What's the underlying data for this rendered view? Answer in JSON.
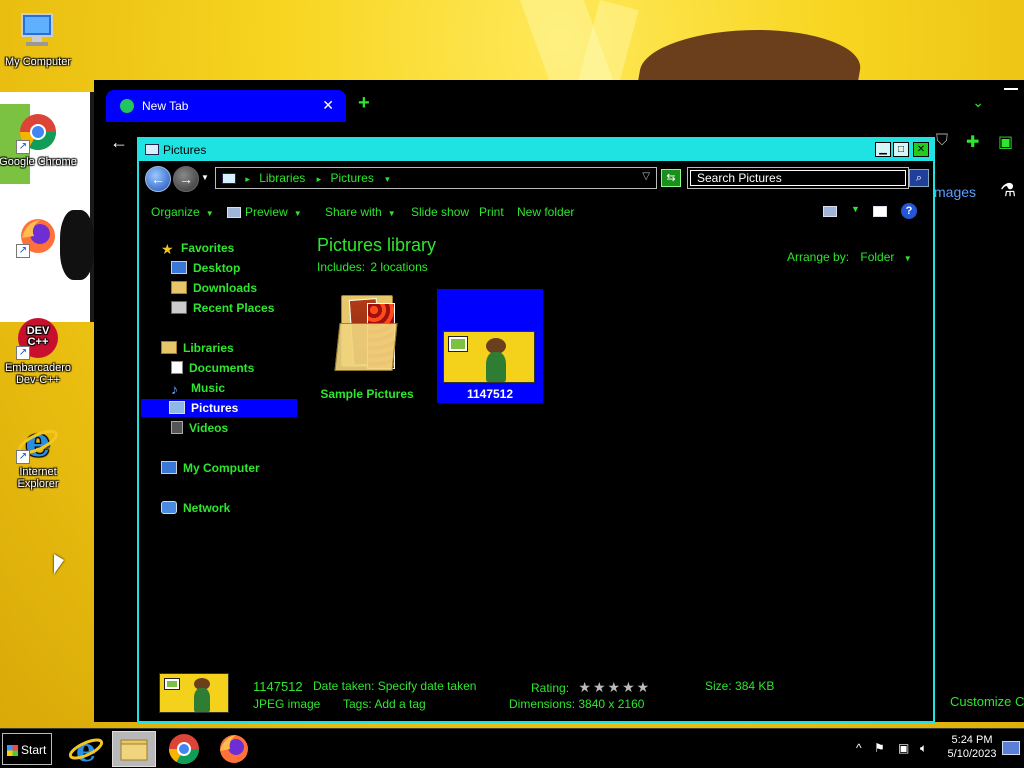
{
  "desktop": {
    "icons": [
      {
        "label": "My Computer",
        "icon": "monitor-icon"
      },
      {
        "label": "Google Chrome",
        "icon": "chrome-icon"
      },
      {
        "label": "Firefox",
        "icon": "firefox-icon"
      },
      {
        "label": "Embarcadero Dev-C++",
        "icon": "devcpp-icon"
      },
      {
        "label": "Internet Explorer",
        "icon": "ie-icon"
      }
    ],
    "devcpp_badge": "DEV C++"
  },
  "browser": {
    "tab_title": "New Tab",
    "tab_close": "✕",
    "new_tab": "+",
    "back": "←",
    "images_link": "mages",
    "customize_link": "Customize C"
  },
  "explorer": {
    "title": "Pictures",
    "controls": {
      "minimize": "▁",
      "maximize": "□",
      "close": "✕"
    },
    "address": {
      "crumbs": [
        "Libraries",
        "Pictures"
      ]
    },
    "search": {
      "placeholder": "Search Pictures"
    },
    "toolbar": {
      "organize": "Organize",
      "preview": "Preview",
      "share_with": "Share with",
      "slide_show": "Slide show",
      "print": "Print",
      "new_folder": "New folder",
      "help": "?"
    },
    "nav": {
      "favorites": "Favorites",
      "desktop": "Desktop",
      "downloads": "Downloads",
      "recent_places": "Recent Places",
      "libraries": "Libraries",
      "documents": "Documents",
      "music": "Music",
      "pictures": "Pictures",
      "videos": "Videos",
      "my_computer": "My Computer",
      "network": "Network"
    },
    "content": {
      "title": "Pictures library",
      "includes_label": "Includes:",
      "includes_value": "2 locations",
      "arrange_label": "Arrange by:",
      "arrange_value": "Folder",
      "items": [
        {
          "name": "Sample Pictures",
          "type": "folder"
        },
        {
          "name": "1147512",
          "type": "image",
          "selected": true
        }
      ]
    },
    "details": {
      "filename": "1147512",
      "filetype": "JPEG image",
      "date_taken_label": "Date taken:",
      "date_taken_value": "Specify date taken",
      "tags_label": "Tags:",
      "tags_value": "Add a tag",
      "rating_label": "Rating:",
      "rating_stars": 0,
      "rating_max": 5,
      "dimensions_label": "Dimensions:",
      "dimensions_value": "3840 x 2160",
      "size_label": "Size:",
      "size_value": "384 KB"
    }
  },
  "taskbar": {
    "start_label": "Start",
    "apps": [
      "ie-icon",
      "explorer-icon",
      "chrome-icon",
      "firefox-icon"
    ],
    "clock_time": "5:24 PM",
    "clock_date": "5/10/2023",
    "tray_overflow": "^"
  },
  "colors": {
    "accent_green": "#2ee62e",
    "title_cyan": "#1fe3e3",
    "selection_blue": "#0000ff",
    "wallpaper_yellow": "#f2cf1a"
  }
}
